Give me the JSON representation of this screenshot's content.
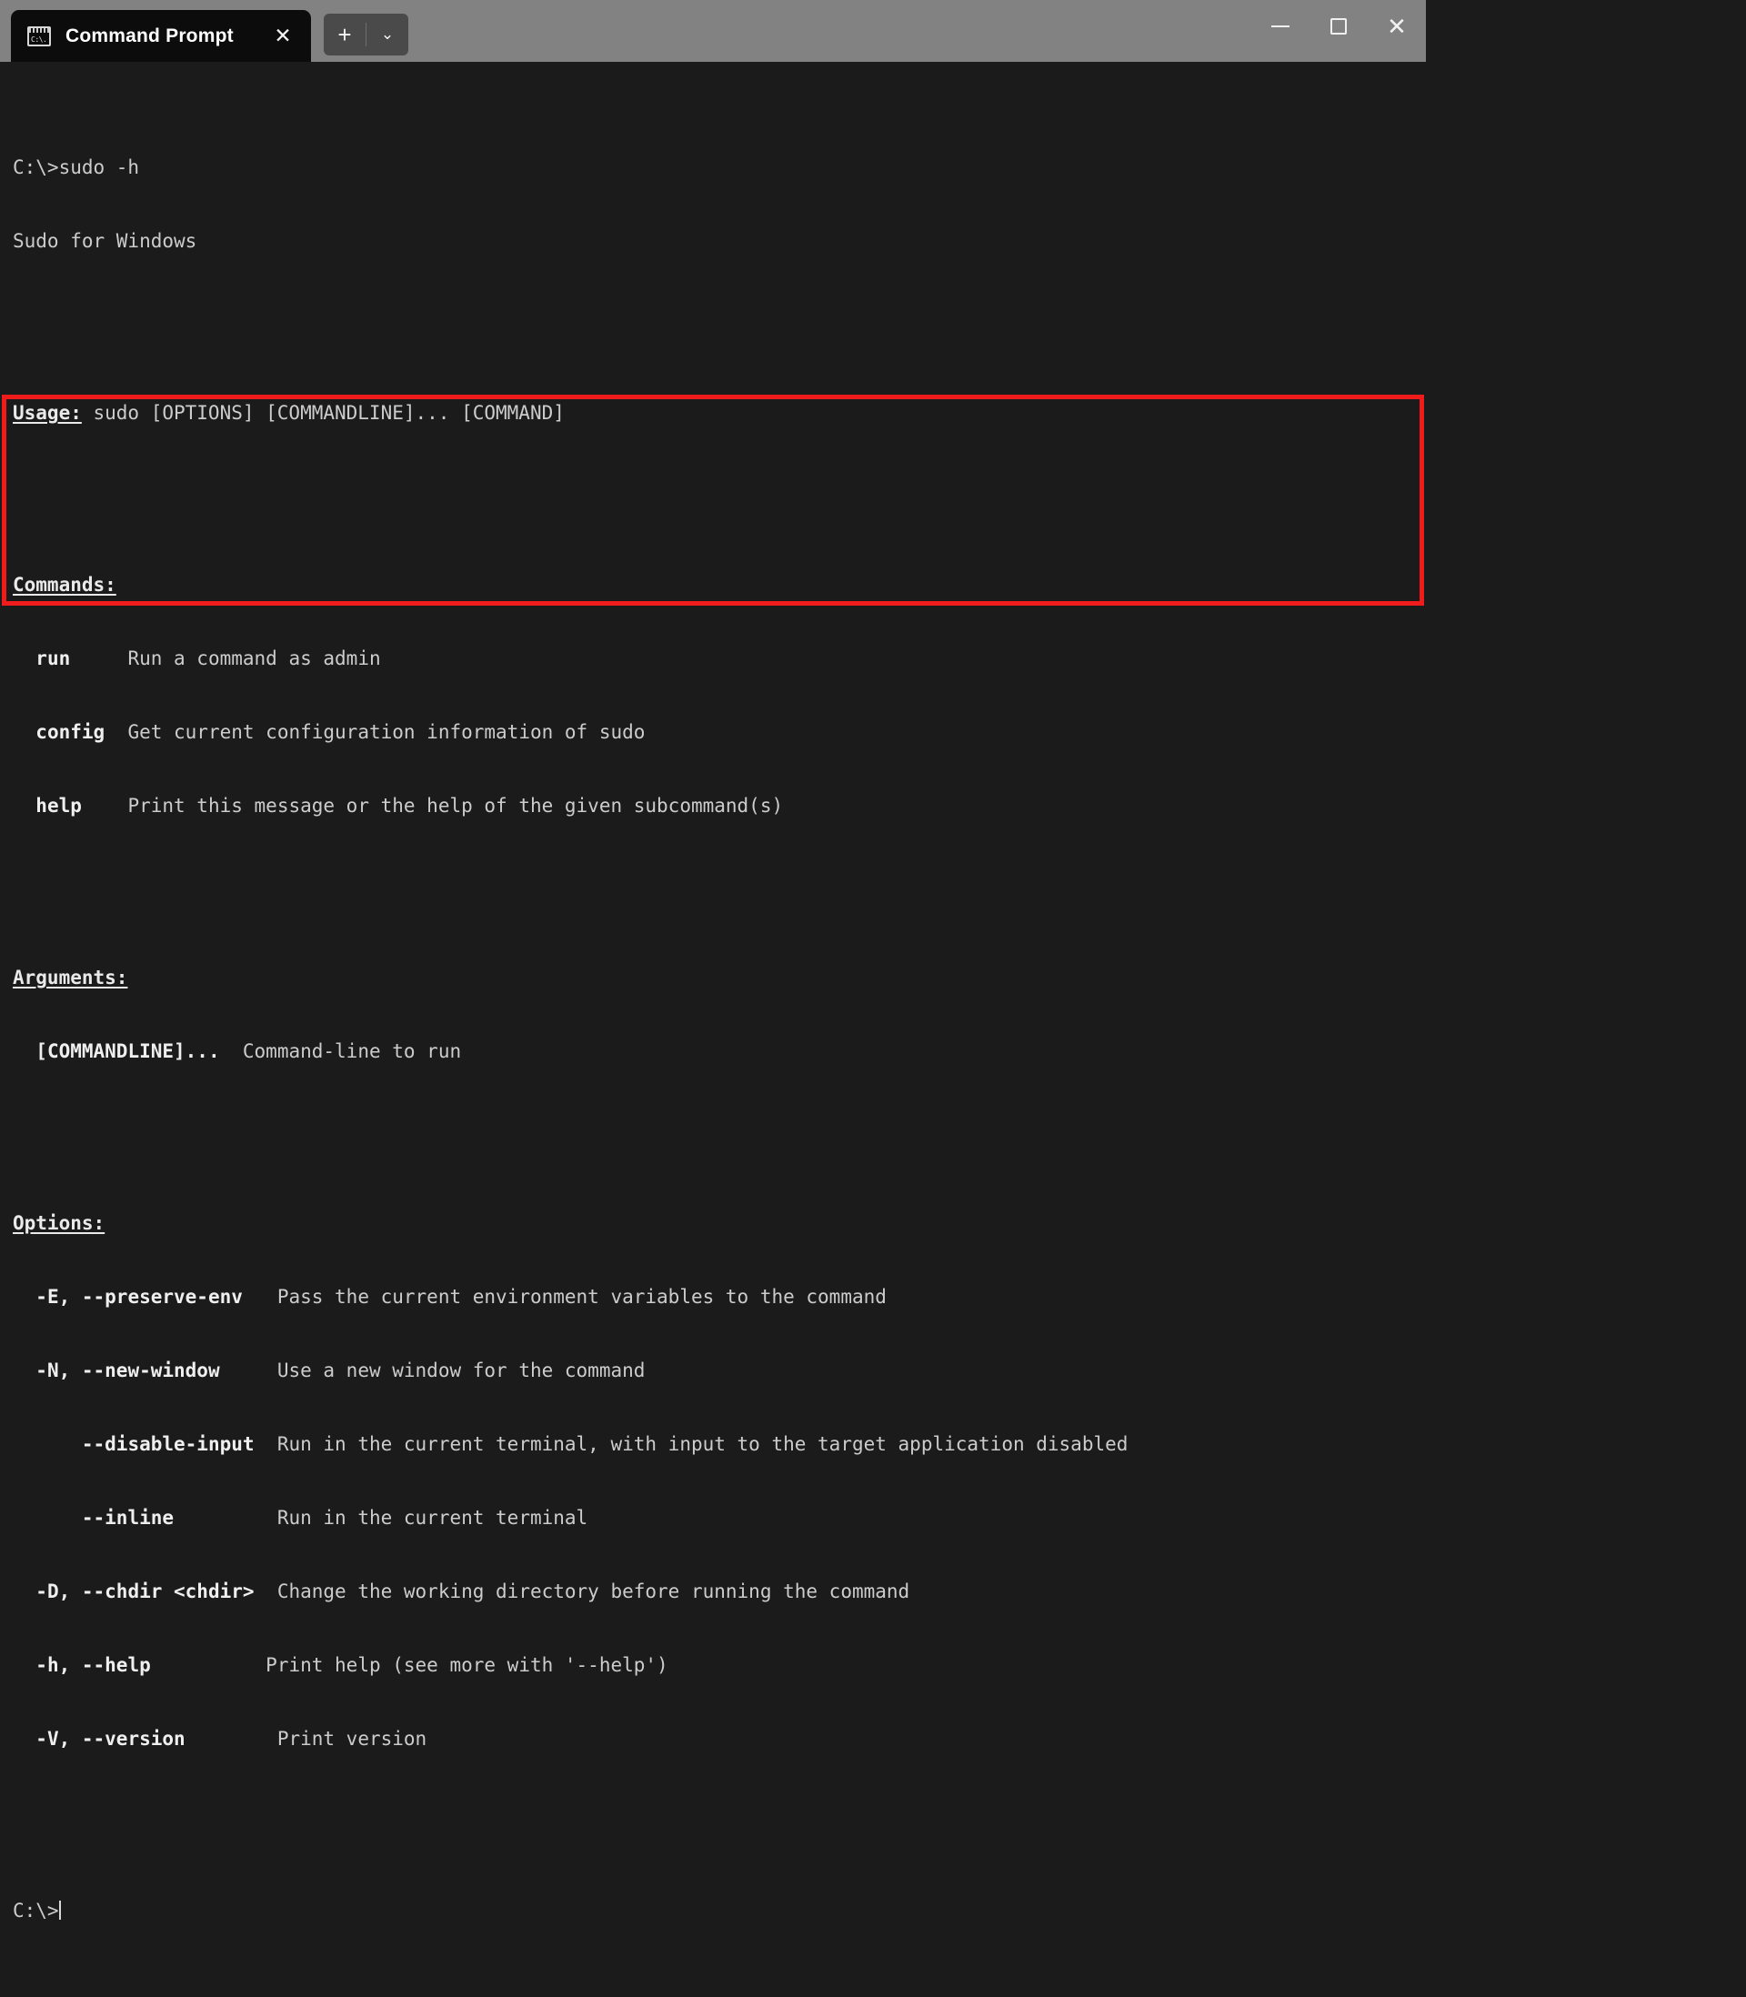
{
  "window": {
    "app_title": "Command Prompt",
    "controls": {
      "minimize": "minimize-button",
      "maximize": "maximize-button",
      "close": "close-button"
    }
  },
  "tab": {
    "title": "Command Prompt",
    "icon_label": "C:\\.",
    "close_glyph": "✕"
  },
  "tabbar": {
    "new_tab_glyph": "+",
    "dropdown_glyph": "⌄"
  },
  "titlebar_glyphs": {
    "minimize": "—",
    "maximize": "□",
    "close": "✕"
  },
  "colors": {
    "titlebar": "#828282",
    "terminal_bg": "#1b1b1b",
    "tab_bg": "#0c0c0c",
    "terminal_fg": "#cccccc",
    "highlight": "#f01c1c"
  },
  "terminal": {
    "prompt_command": "C:\\>sudo -h",
    "program_title": "Sudo for Windows",
    "usage_label": "Usage:",
    "usage_text": " sudo [OPTIONS] [COMMANDLINE]... [COMMAND]",
    "commands_label": "Commands:",
    "commands": [
      {
        "name": "run",
        "pad": "     ",
        "desc": "Run a command as admin"
      },
      {
        "name": "config",
        "pad": "  ",
        "desc": "Get current configuration information of sudo"
      },
      {
        "name": "help",
        "pad": "    ",
        "desc": "Print this message or the help of the given subcommand(s)"
      }
    ],
    "arguments_label": "Arguments:",
    "arguments": [
      {
        "name": "[COMMANDLINE]...",
        "pad": "  ",
        "desc": "Command-line to run"
      }
    ],
    "options_label": "Options:",
    "options": [
      {
        "flag": "-E, --preserve-env",
        "pad": "   ",
        "desc": "Pass the current environment variables to the command"
      },
      {
        "flag": "-N, --new-window",
        "pad": "     ",
        "desc": "Use a new window for the command"
      },
      {
        "flag": "    --disable-input",
        "pad": "  ",
        "desc": "Run in the current terminal, with input to the target application disabled"
      },
      {
        "flag": "    --inline",
        "pad": "         ",
        "desc": "Run in the current terminal"
      },
      {
        "flag": "-D, --chdir <chdir>",
        "pad": "  ",
        "desc": "Change the working directory before running the command"
      },
      {
        "flag": "-h, --help",
        "pad": "          ",
        "desc": "Print help (see more with '--help')"
      },
      {
        "flag": "-V, --version",
        "pad": "        ",
        "desc": "Print version"
      }
    ],
    "final_prompt": "C:\\>"
  }
}
